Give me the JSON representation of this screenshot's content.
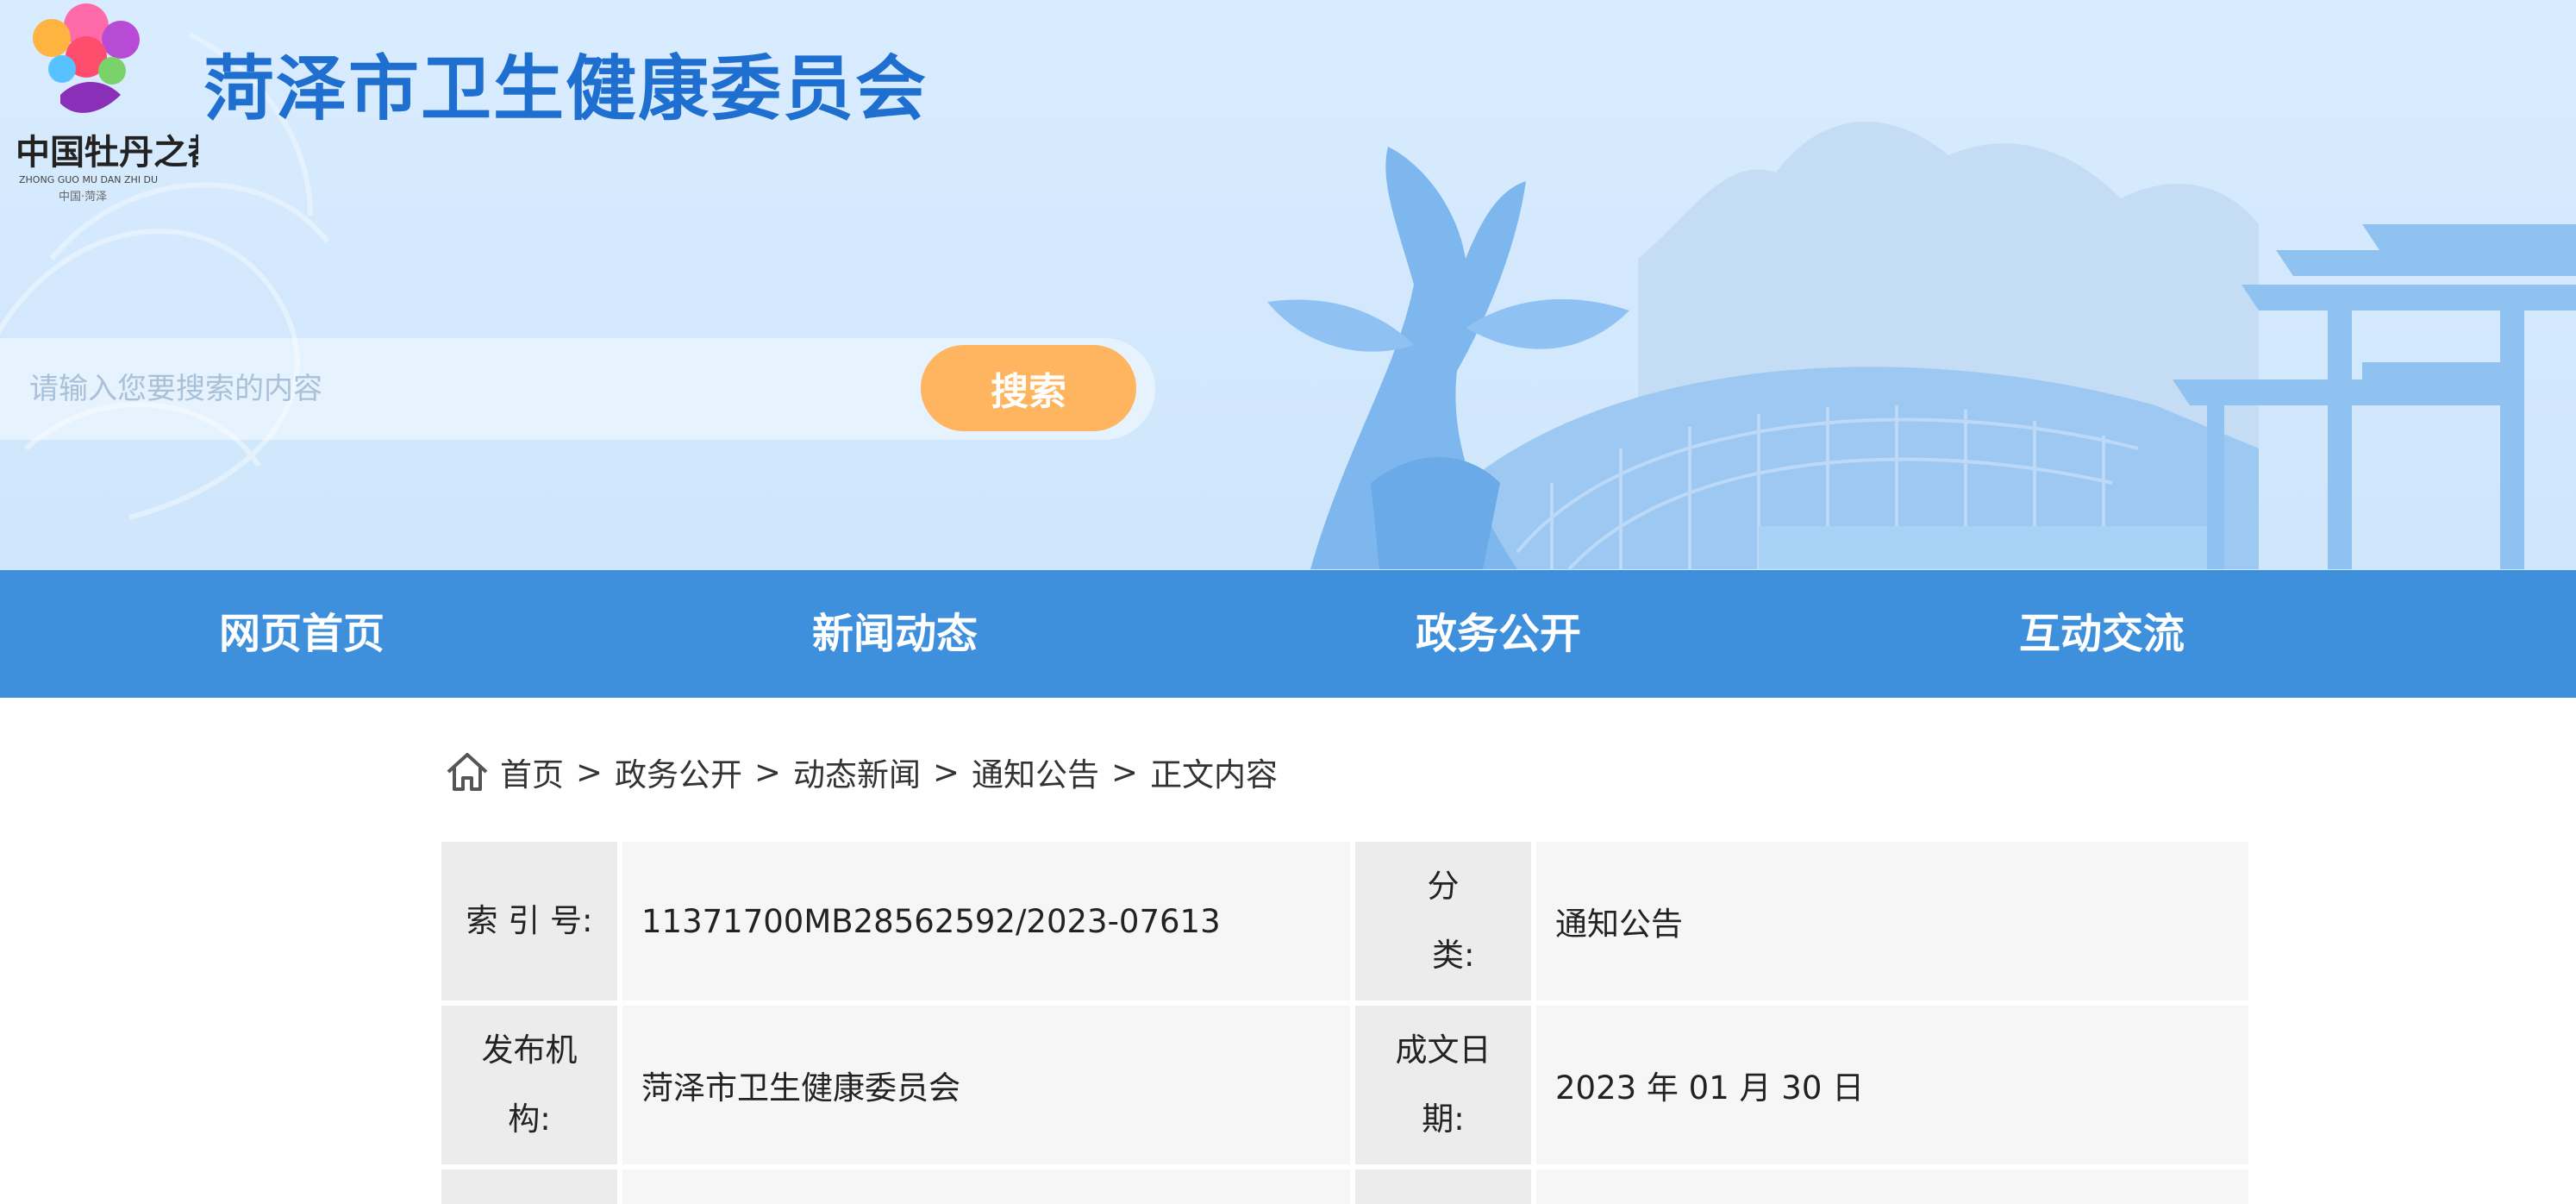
{
  "header": {
    "site_title": "菏泽市卫生健康委员会",
    "logo_text": "中国牡丹之都",
    "logo_subtext": "ZHONG GUO MU DAN ZHI DU",
    "logo_caption": "中国·菏泽",
    "search": {
      "placeholder": "请输入您要搜索的内容",
      "value": "",
      "button_label": "搜索"
    }
  },
  "nav": {
    "items": [
      {
        "label": "网页首页"
      },
      {
        "label": "新闻动态"
      },
      {
        "label": "政务公开"
      },
      {
        "label": "互动交流"
      }
    ]
  },
  "breadcrumb": {
    "items": [
      "首页",
      "政务公开",
      "动态新闻",
      "通知公告",
      "正文内容"
    ],
    "separator": ">"
  },
  "info_table": {
    "rows": [
      {
        "label1": "索 引 号:",
        "value1": "11371700MB28562592/2023-07613",
        "label2": "分\n  类:",
        "value2": "通知公告"
      },
      {
        "label1": "发布机\n构:",
        "value1": "菏泽市卫生健康委员会",
        "label2": "成文日\n期:",
        "value2": "2023 年 01 月 30 日"
      }
    ]
  },
  "colors": {
    "title": "#1e6fd0",
    "nav_bg": "#3f90dc",
    "search_button": "#ffb55f",
    "banner_bg": "#d9ecff"
  },
  "icons": {
    "home": "home-icon",
    "logo": "peony-logo-icon"
  }
}
